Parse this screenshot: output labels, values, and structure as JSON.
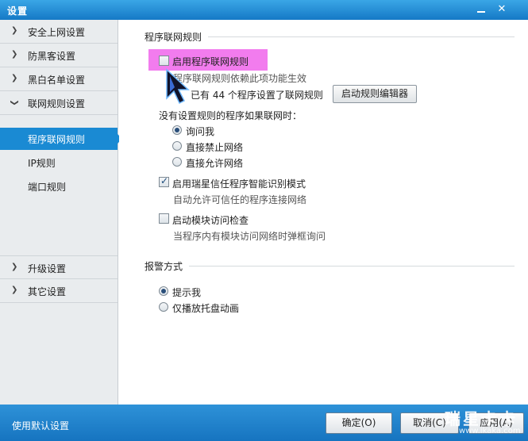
{
  "window": {
    "title": "设置"
  },
  "sidebar": {
    "items": [
      {
        "label": "安全上网设置"
      },
      {
        "label": "防黑客设置"
      },
      {
        "label": "黑白名单设置"
      },
      {
        "label": "联网规则设置"
      }
    ],
    "sub_items": [
      {
        "label": "程序联网规则",
        "active": true
      },
      {
        "label": "IP规则"
      },
      {
        "label": "端口规则"
      }
    ],
    "bottom_items": [
      {
        "label": "升级设置"
      },
      {
        "label": "其它设置"
      }
    ]
  },
  "main": {
    "section1_title": "程序联网规则",
    "enable_rules_label": "启用程序联网规则",
    "enable_rules_checked": false,
    "enable_rules_desc": "程序联网规则依赖此项功能生效",
    "rules_count_text": "已有 44 个程序设置了联网规则",
    "rule_editor_button": "启动规则编辑器",
    "no_rule_question": "没有设置规则的程序如果联网时：",
    "no_rule_options": [
      {
        "label": "询问我",
        "checked": true
      },
      {
        "label": "直接禁止网络",
        "checked": false
      },
      {
        "label": "直接允许网络",
        "checked": false
      }
    ],
    "trust_mode_label": "启用瑞星信任程序智能识别模式",
    "trust_mode_checked": true,
    "trust_mode_desc": "自动允许可信任的程序连接网络",
    "module_check_label": "启动模块访问检查",
    "module_check_checked": false,
    "module_check_desc": "当程序内有模块访问网络时弹框询问",
    "section2_title": "报警方式",
    "alarm_options": [
      {
        "label": "提示我",
        "checked": true
      },
      {
        "label": "仅播放托盘动画",
        "checked": false
      }
    ]
  },
  "footer": {
    "default_link": "使用默认设置",
    "ok_button": "确定(O)",
    "cancel_button": "取消(C)",
    "apply_button": "应用(A)",
    "watermark_main": "瑞星卡卡",
    "watermark_sub": "www.ikaka.com"
  },
  "colors": {
    "titlebar": "#1f8ad6",
    "active_nav": "#1a8ad3",
    "highlight": "#f27cee",
    "footer": "#1f84cc"
  }
}
